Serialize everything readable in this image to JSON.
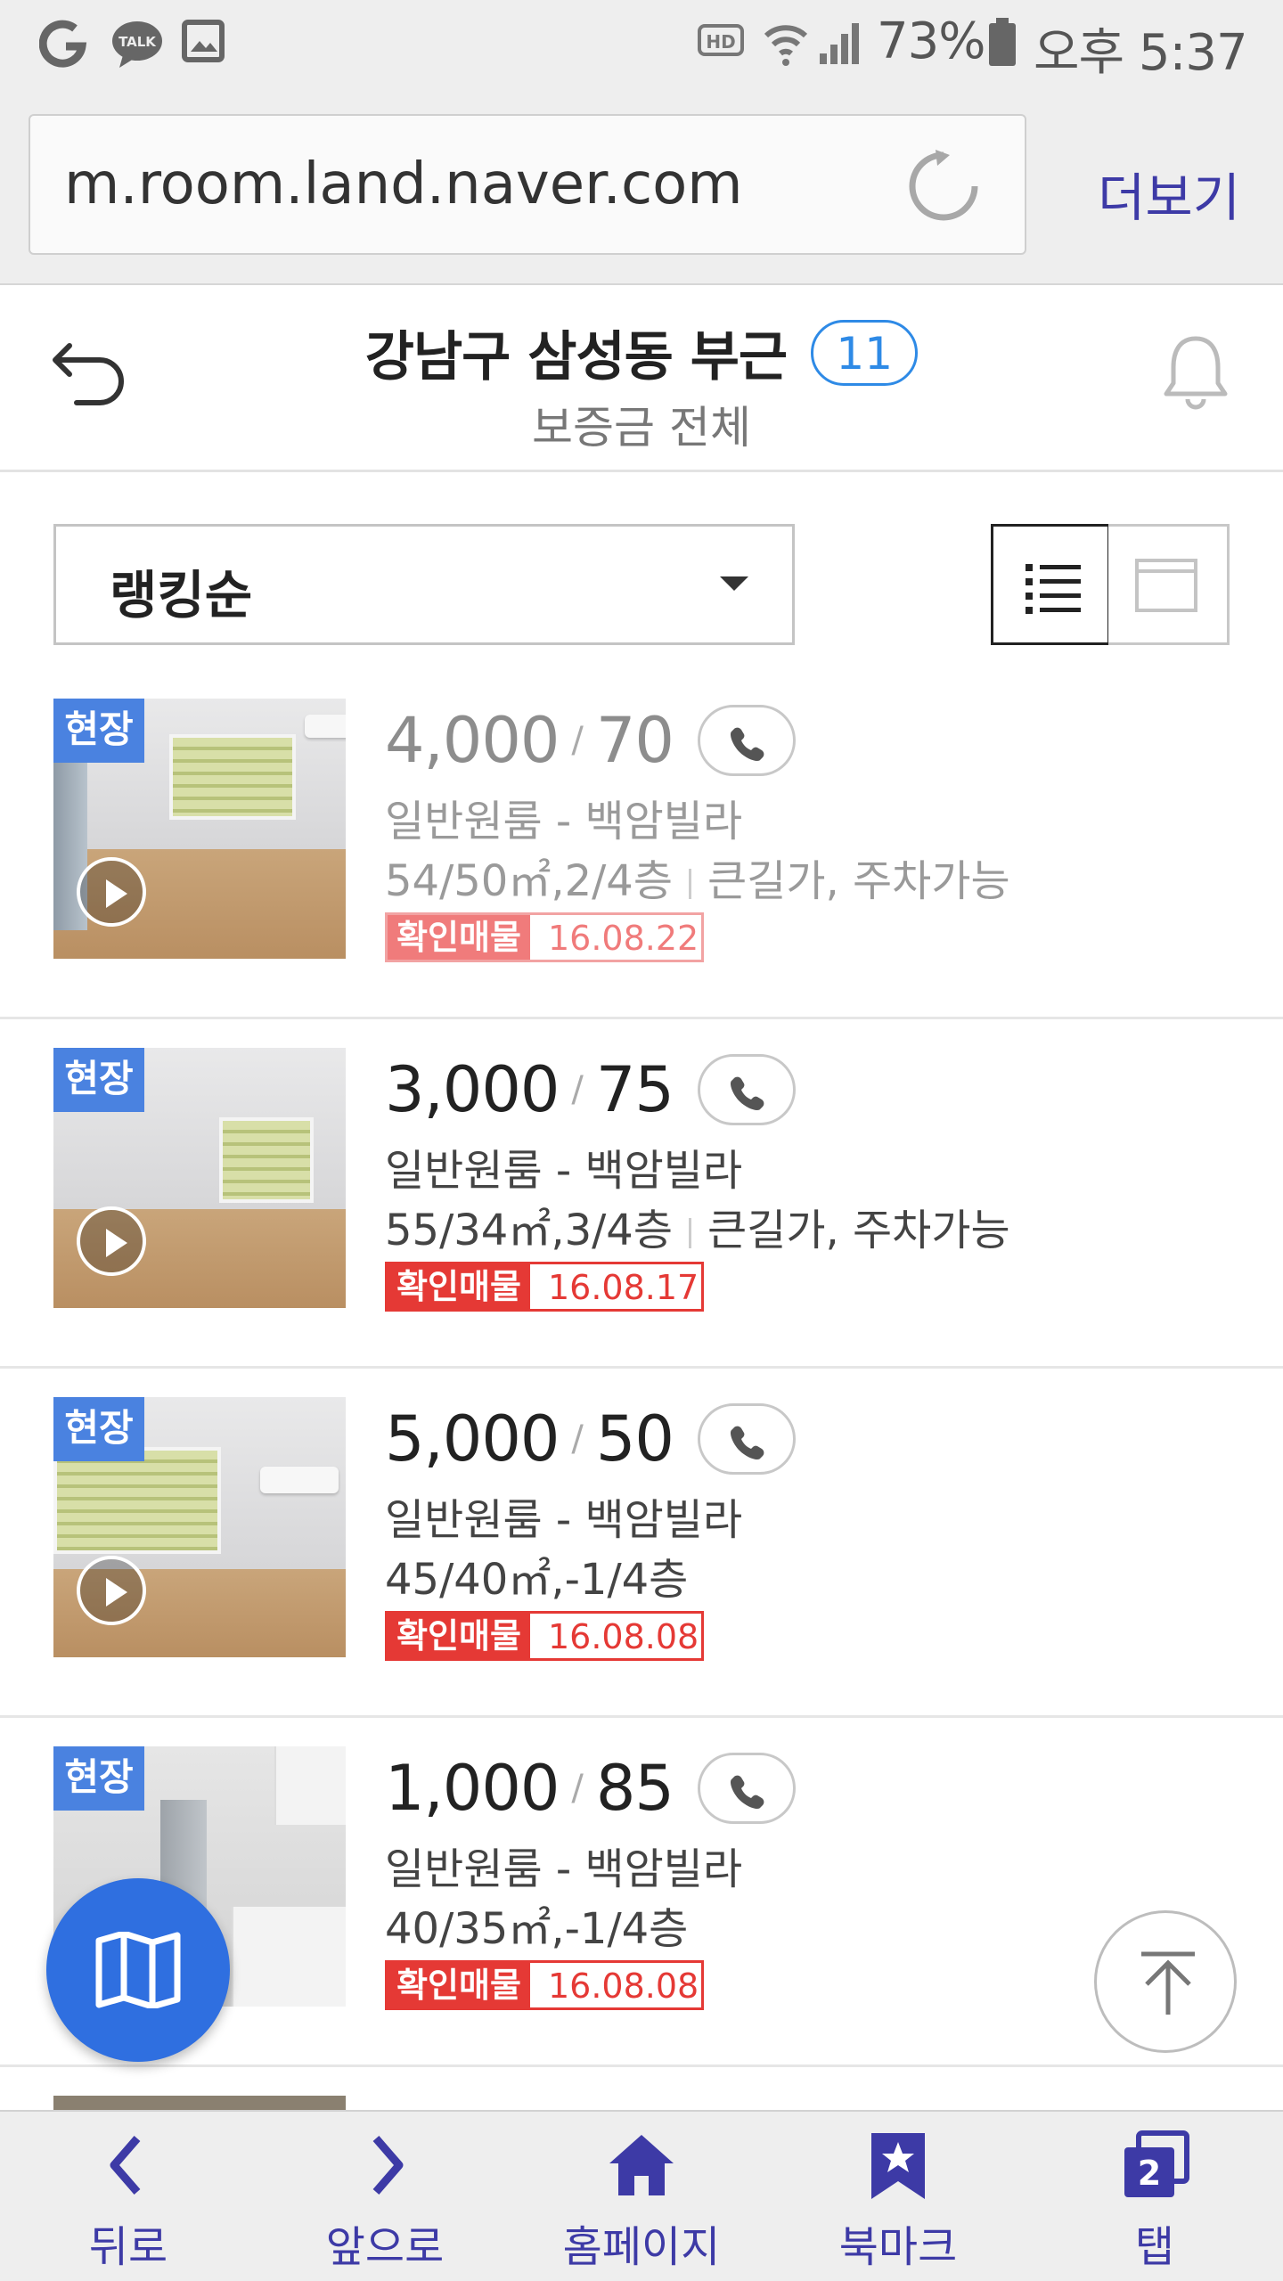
{
  "status_bar": {
    "battery": "73%",
    "time": "오후 5:37",
    "icons": [
      "carrier-g-icon",
      "kakaotalk-icon",
      "gallery-icon",
      "hd-icon",
      "wifi-icon",
      "signal-icon",
      "battery-icon"
    ],
    "talk_label": "TALK",
    "hd_label": "HD"
  },
  "browser": {
    "url": "m.room.land.naver.com",
    "more_label": "더보기",
    "accent": "#3d3aa6"
  },
  "header": {
    "title": "강남구 삼성동 부근",
    "count": "11",
    "subtitle": "보증금 전체"
  },
  "sort": {
    "selected": "랭킹순"
  },
  "listings": [
    {
      "tag": "현장",
      "deposit": "4,000",
      "sep": "/",
      "rent": "70",
      "type": "일반원룸 - 백암빌라",
      "spec": "54/50㎡,2/4층",
      "features": "큰길가, 주차가능",
      "verified_label": "확인매물",
      "date": "16.08.22"
    },
    {
      "tag": "현장",
      "deposit": "3,000",
      "sep": "/",
      "rent": "75",
      "type": "일반원룸 - 백암빌라",
      "spec": "55/34㎡,3/4층",
      "features": "큰길가, 주차가능",
      "verified_label": "확인매물",
      "date": "16.08.17"
    },
    {
      "tag": "현장",
      "deposit": "5,000",
      "sep": "/",
      "rent": "50",
      "type": "일반원룸 - 백암빌라",
      "spec": "45/40㎡,-1/4층",
      "features": "",
      "verified_label": "확인매물",
      "date": "16.08.08"
    },
    {
      "tag": "현장",
      "deposit": "1,000",
      "sep": "/",
      "rent": "85",
      "type": "일반원룸 - 백암빌라",
      "spec": "40/35㎡,-1/4층",
      "features": "",
      "verified_label": "확인매물",
      "date": "16.08.08"
    }
  ],
  "bottom_nav": [
    {
      "label": "뒤로",
      "icon": "chevron-left-icon"
    },
    {
      "label": "앞으로",
      "icon": "chevron-right-icon"
    },
    {
      "label": "홈페이지",
      "icon": "home-icon"
    },
    {
      "label": "북마크",
      "icon": "bookmark-icon"
    },
    {
      "label": "탭",
      "icon": "tabs-icon",
      "badge": "2"
    }
  ],
  "colors": {
    "badge_blue": "#2e8ae6",
    "tag_blue": "#4a82e0",
    "verified_red": "#e53935",
    "map_fab": "#2f6fe0"
  }
}
